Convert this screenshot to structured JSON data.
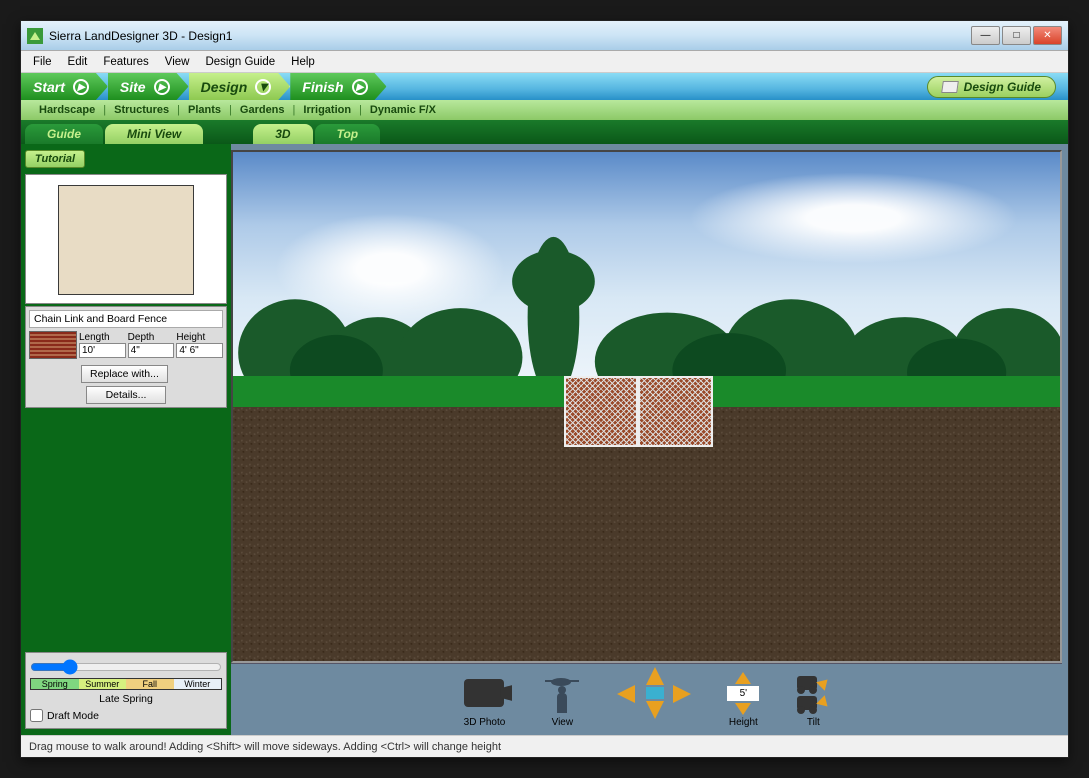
{
  "window": {
    "title": "Sierra LandDesigner 3D - Design1"
  },
  "menubar": [
    "File",
    "Edit",
    "Features",
    "View",
    "Design Guide",
    "Help"
  ],
  "phases": {
    "items": [
      "Start",
      "Site",
      "Design",
      "Finish"
    ],
    "active_index": 2,
    "guide_label": "Design Guide"
  },
  "sub_tabs": [
    "Hardscape",
    "Structures",
    "Plants",
    "Gardens",
    "Irrigation",
    "Dynamic F/X"
  ],
  "left_tabs": {
    "items": [
      "Guide",
      "Mini View"
    ],
    "active_index": 1
  },
  "right_tabs": {
    "items": [
      "3D",
      "Top"
    ],
    "active_index": 0
  },
  "sidebar": {
    "tutorial_label": "Tutorial",
    "selected_object": "Chain Link and Board Fence",
    "dims": {
      "length_label": "Length",
      "length_value": "10'",
      "depth_label": "Depth",
      "depth_value": "4\"",
      "height_label": "Height",
      "height_value": "4' 6\""
    },
    "replace_label": "Replace with...",
    "details_label": "Details...",
    "seasons": {
      "spring": "Spring",
      "summer": "Summer",
      "fall": "Fall",
      "winter": "Winter",
      "current": "Late Spring"
    },
    "draft_mode_label": "Draft Mode",
    "draft_mode_checked": false
  },
  "nav_toolbar": {
    "photo_label": "3D Photo",
    "view_label": "View",
    "height_label": "Height",
    "height_value": "5'",
    "tilt_label": "Tilt"
  },
  "statusbar": {
    "text": "Drag mouse to walk around!  Adding <Shift> will move sideways. Adding <Ctrl> will change height"
  }
}
